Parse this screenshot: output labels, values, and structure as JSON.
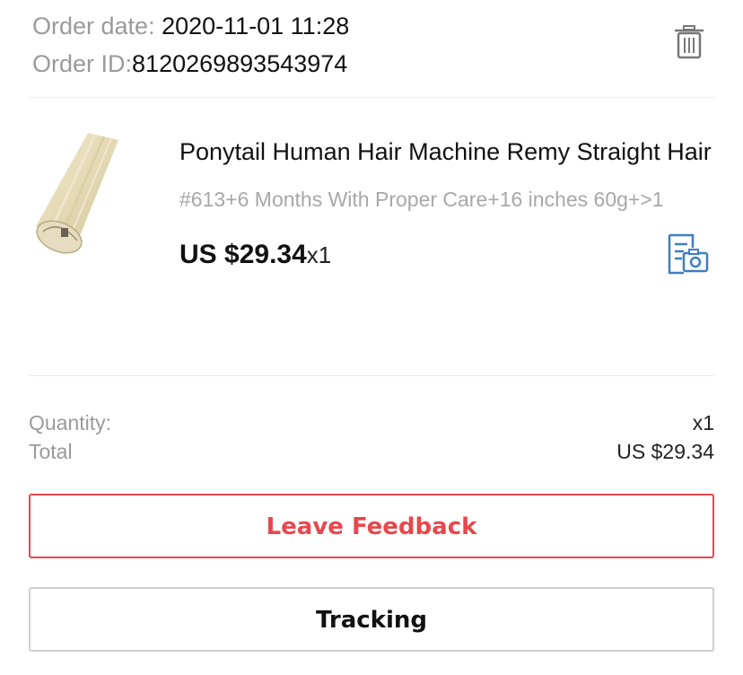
{
  "order": {
    "date_label": "Order date: ",
    "date_value": "2020-11-01 11:28",
    "id_label": "Order ID:",
    "id_value": "8120269893543974",
    "delete_icon": "trash-icon"
  },
  "product": {
    "title": "Ponytail Human Hair Machine Remy Straight Hair",
    "sku": "#613+6 Months With Proper Care+16 inches 60g+>1",
    "price": "US $29.34",
    "quantity": "x1",
    "image_icon": "hair-ponytail-thumbnail",
    "receipt_icon": "receipt-camera-icon"
  },
  "summary": {
    "quantity_label": "Quantity:",
    "quantity_value": "x1",
    "total_label": "Total",
    "total_value": "US $29.34"
  },
  "actions": {
    "feedback_label": "Leave Feedback",
    "tracking_label": "Tracking"
  },
  "colors": {
    "accent": "#e8474d",
    "icon_blue": "#3d7fc1",
    "muted_text": "#9a9a9a"
  }
}
